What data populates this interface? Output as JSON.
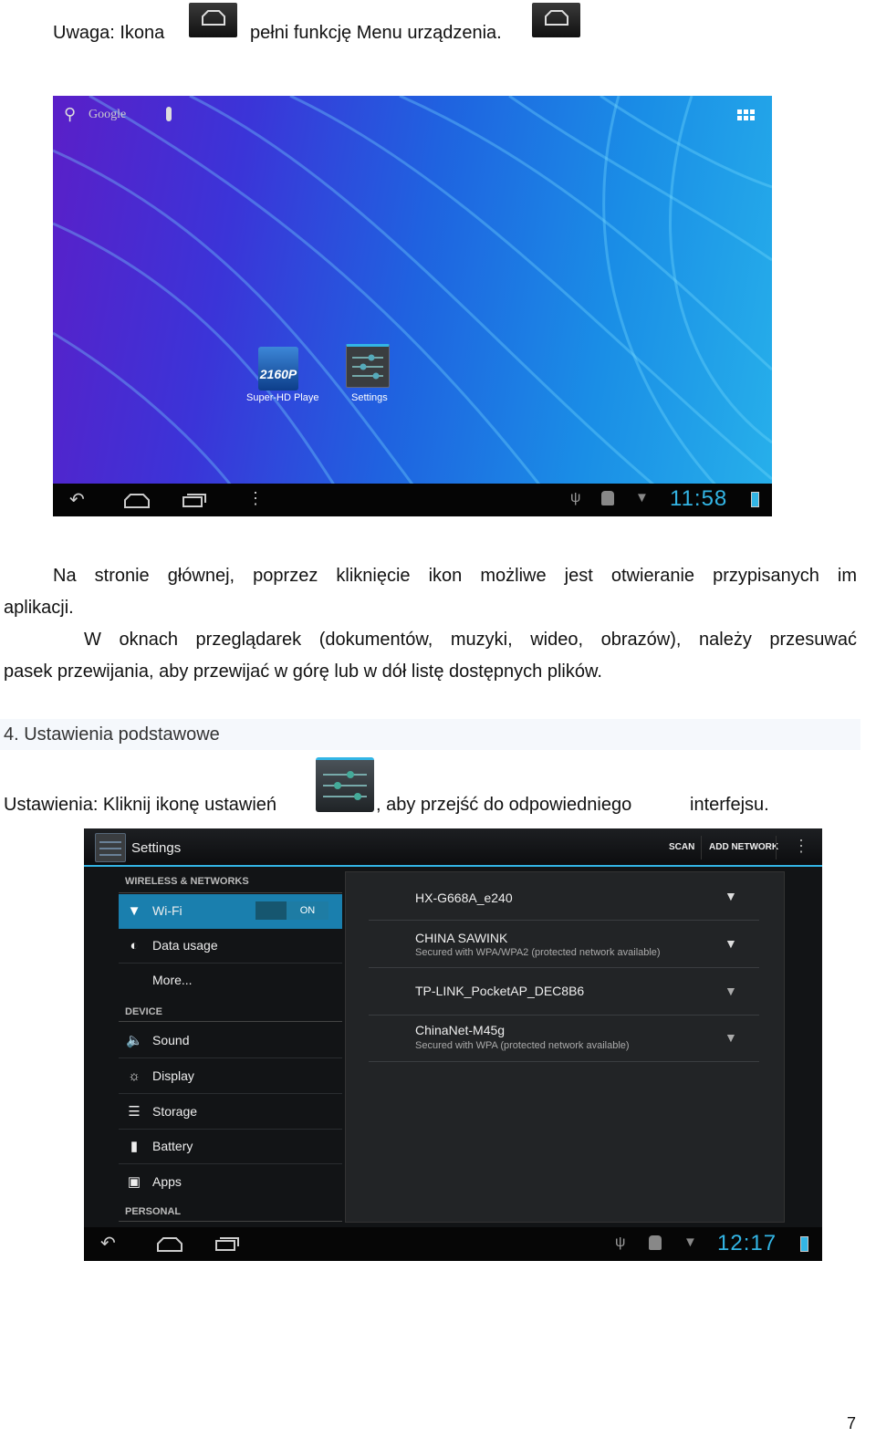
{
  "note_line": {
    "prefix": "Uwaga: Ikona",
    "suffix": "pełni funkcję Menu urządzenia.",
    "icon": "home-icon"
  },
  "home_screen": {
    "search_label": "Google",
    "apps": [
      {
        "label": "Super-HD Playe",
        "icon_text": "2160P"
      },
      {
        "label": "Settings"
      }
    ],
    "clock": "11:58",
    "colors": {
      "wallpaper_left": "#5a1fc8",
      "wallpaper_right": "#27b0ea",
      "clock": "#33b5e5"
    }
  },
  "paragraph1": {
    "line1": "Na stronie głównej, poprzez kliknięcie ikon możliwe jest otwieranie przypisanych im",
    "line2": "aplikacji."
  },
  "paragraph2": {
    "line1": "W oknach przeglądarek (dokumentów, muzyki, wideo, obrazów), należy przesuwać",
    "line2": "pasek przewijania, aby przewijać w górę lub w dół listę dostępnych plików."
  },
  "section_heading": "4. Ustawienia podstawowe",
  "settings_line": {
    "prefix": "Ustawienia: Kliknij ikonę ustawień",
    "middle": ", aby przejść do odpowiedniego",
    "suffix": "interfejsu."
  },
  "settings_screen": {
    "title": "Settings",
    "actions": {
      "scan": "SCAN",
      "add_network": "ADD NETWORK"
    },
    "sections": {
      "wireless": "WIRELESS & NETWORKS",
      "device": "DEVICE",
      "personal": "PERSONAL"
    },
    "items": {
      "wifi": "Wi-Fi",
      "wifi_toggle": "ON",
      "data_usage": "Data usage",
      "more": "More...",
      "sound": "Sound",
      "display": "Display",
      "storage": "Storage",
      "battery": "Battery",
      "apps": "Apps"
    },
    "networks": [
      {
        "name": "HX-G668A_e240",
        "status": ""
      },
      {
        "name": "CHINA SAWINK",
        "status": "Secured with WPA/WPA2 (protected network available)"
      },
      {
        "name": "TP-LINK_PocketAP_DEC8B6",
        "status": ""
      },
      {
        "name": "ChinaNet-M45g",
        "status": "Secured with WPA (protected network available)"
      }
    ],
    "clock": "12:17",
    "colors": {
      "accent": "#33b5e5",
      "selected": "#1a7fae"
    }
  },
  "page_number": "7"
}
